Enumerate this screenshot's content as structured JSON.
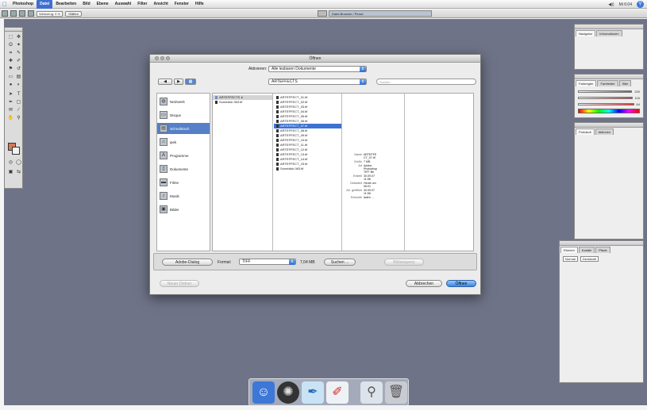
{
  "menubar": {
    "app_name": "Photoshop",
    "items": [
      "Datei",
      "Bearbeiten",
      "Bild",
      "Ebene",
      "Auswahl",
      "Filter",
      "Ansicht",
      "Fenster",
      "Hilfe"
    ],
    "active_item": "Datei",
    "clock": "Mi 6:04"
  },
  "optionsbar": {
    "field1": "Werkzeug: 0 %",
    "button1": "Glätten",
    "palette_tab": "Datei-Browser / Pinsel"
  },
  "dialog": {
    "title": "Öffnen",
    "aktivieren_label": "Aktivieren:",
    "aktivieren_value": "Alle lesbaren Dokumente",
    "location_value": "ARTEFFECTS",
    "search_placeholder": "Suchen",
    "nav_back": "◀",
    "nav_forward": "▶",
    "view_mode": "▦",
    "sidebar": [
      {
        "label": "Netzwerk",
        "icon": "network-icon"
      },
      {
        "label": "Disque",
        "icon": "disk-icon"
      },
      {
        "label": "Schreibtisch",
        "icon": "desktop-icon",
        "selected": true
      },
      {
        "label": "ipek",
        "icon": "home-icon"
      },
      {
        "label": "Programme",
        "icon": "applications-icon"
      },
      {
        "label": "Dokumente",
        "icon": "documents-icon"
      },
      {
        "label": "Filme",
        "icon": "movies-icon"
      },
      {
        "label": "Musik",
        "icon": "music-icon"
      },
      {
        "label": "Bilder",
        "icon": "pictures-icon"
      }
    ],
    "column1": [
      {
        "name": "ARTEFFECTS",
        "selected": true,
        "folder": true
      },
      {
        "name": "Sonnblick 063.tif"
      }
    ],
    "column2": [
      "ARTEFFECT_01.tif",
      "ARTEFFECT_02.tif",
      "ARTEFFECT_03.tif",
      "ARTEFFECT_04.tif",
      "ARTEFFECT_05.tif",
      "ARTEFFECT_06.tif",
      "ARTEFFECT_07.tif",
      "ARTEFFECT_08.tif",
      "ARTEFFECT_09.tif",
      "ARTEFFECT_10.tif",
      "ARTEFFECT_11.tif",
      "ARTEFFECT_12.tif",
      "ARTEFFECT_13.tif",
      "ARTEFFECT_14.tif",
      "ARTEFFECT_15.tif",
      "Sonnblick 063.tif"
    ],
    "column2_selected_index": 6,
    "info": [
      {
        "k": "Name",
        "v": "ARTEFFE CT_07.tif"
      },
      {
        "k": "Größe",
        "v": "7 MB"
      },
      {
        "k": "Art",
        "v": "Adobe Photoshop TIFF file"
      },
      {
        "k": "Erstellt",
        "v": "30.09.07 11:58"
      },
      {
        "k": "Geändert",
        "v": "Heute um 06:01"
      },
      {
        "k": "Zul. geöffnet",
        "v": "30.09.07 11:58"
      },
      {
        "k": "Entwurfe",
        "v": "laden ..."
      }
    ],
    "bottom": {
      "adobe_dialog": "Adobe-Dialog",
      "format_label": "Format:",
      "format_value": "TIFF",
      "file_size": "7,04 MB",
      "suchen": "Suchen ...",
      "bild_sequenz": "Bildsequenz",
      "new_folder": "Neuer Ordner",
      "cancel": "Abbrechen",
      "open": "Öffnen"
    }
  },
  "panels": {
    "navigator_tabs": [
      "Navigator",
      "Informationen"
    ],
    "color_tabs": [
      "Farbregler",
      "Farbfelder",
      "Stile"
    ],
    "color_values": [
      "220",
      "116",
      "64"
    ],
    "layers_tabs": [
      "Ebenen",
      "Kanäle",
      "Pfade"
    ],
    "layers_mode": "Normal",
    "layers_opacity": "Deckkraft",
    "history_tabs": [
      "Protokoll",
      "Aktionen"
    ]
  },
  "colors": {
    "desktop": "#6e7387",
    "accent": "#3d72d1",
    "foreground_color": "#d47a55"
  }
}
